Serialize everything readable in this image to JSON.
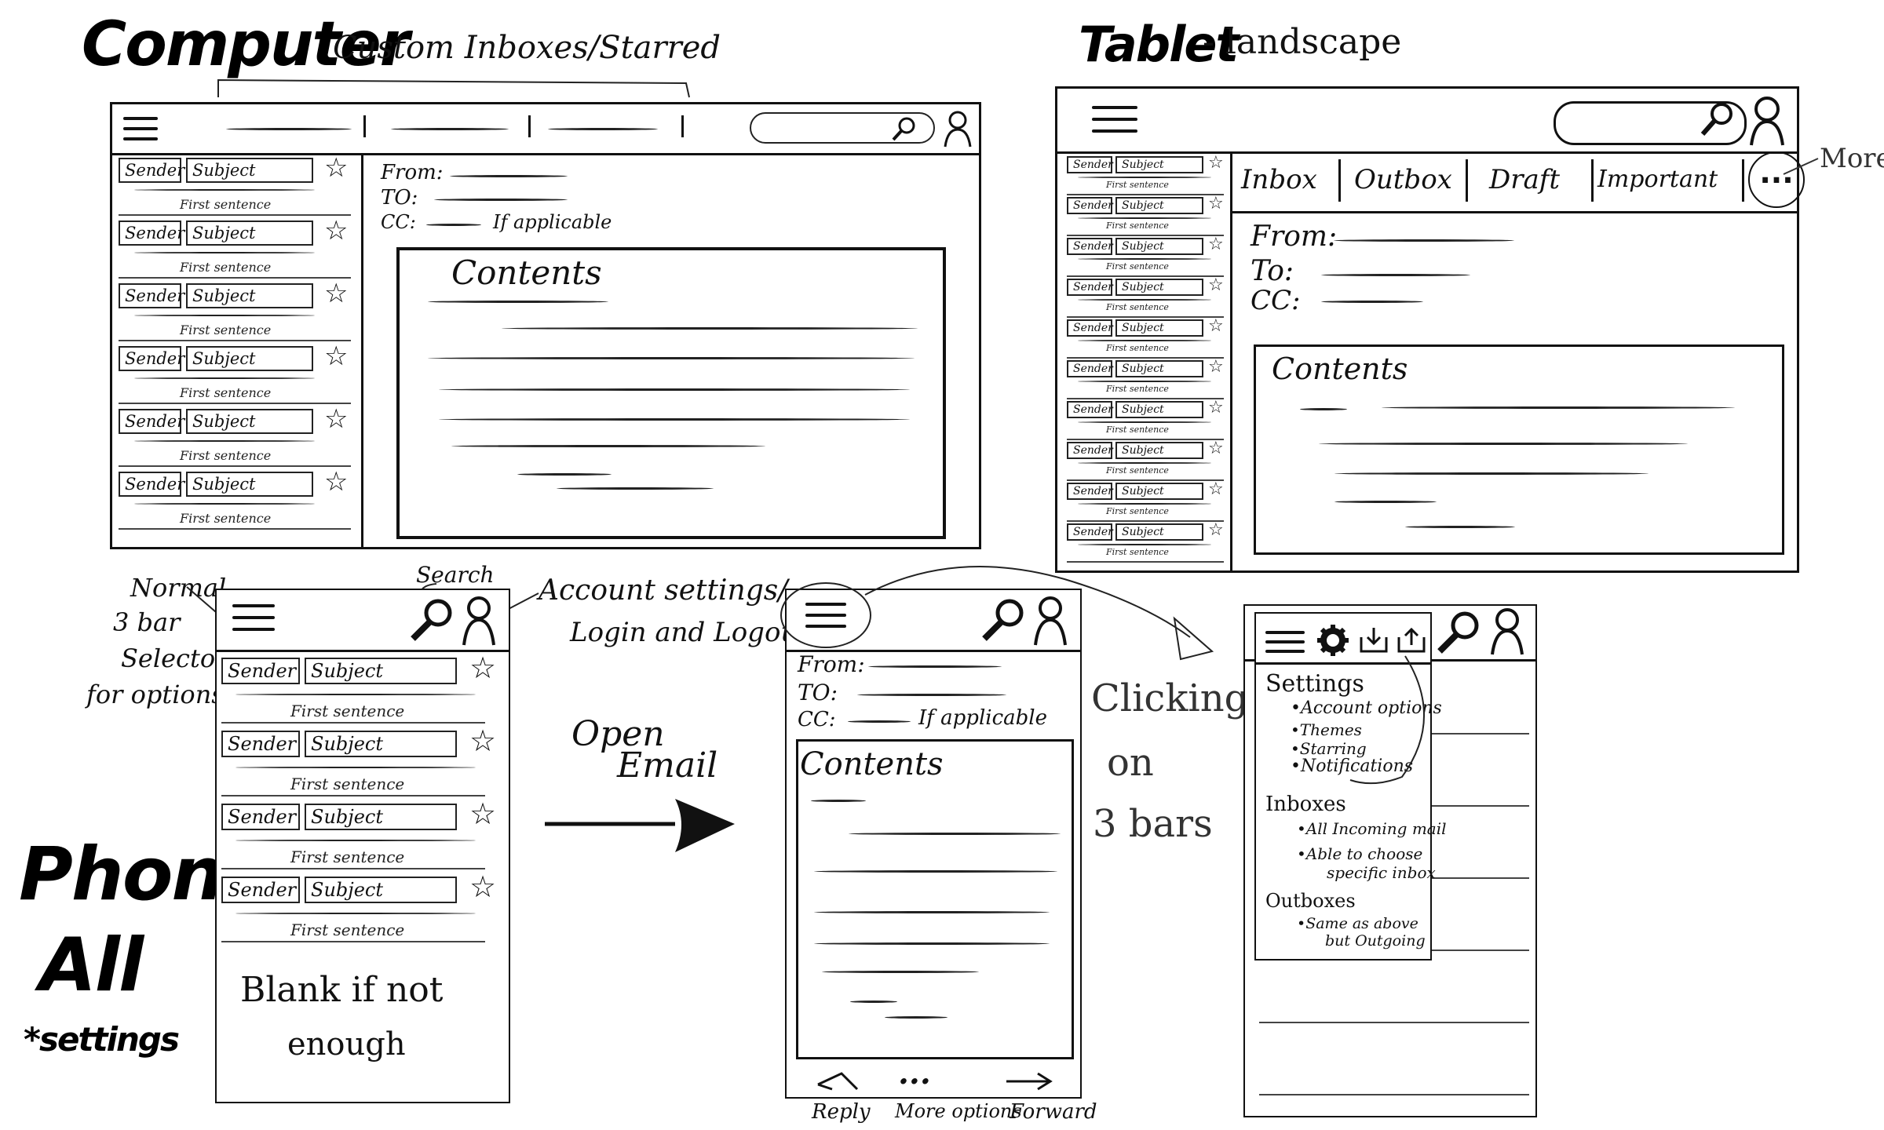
{
  "computer": {
    "title": "Computer",
    "annotation_tabs": "Custom Inboxes/Starred",
    "list_sender": "Sender",
    "list_subject": "Subject",
    "list_sentence": "First sentence",
    "from_label": "From:",
    "to_label": "TO:",
    "cc_label": "CC:",
    "cc_note": "If applicable",
    "contents": "Contents"
  },
  "tablet": {
    "title": "Tablet",
    "subtitle": "- landscape",
    "tabs": [
      "Inbox",
      "Outbox",
      "Draft",
      "Important"
    ],
    "more_button": "...",
    "more_note": "More",
    "from_label": "From:",
    "to_label": "To:",
    "cc_label": "CC:",
    "contents": "Contents",
    "list_sender": "Sender",
    "list_subject": "Subject",
    "list_sentence": "First sentence"
  },
  "phone": {
    "title_line1": "Phone/",
    "title_line2": "All",
    "title_line3": "*settings",
    "note_normal": [
      "Normal",
      "3 bar",
      "Selector",
      "for options"
    ],
    "note_search": "Search",
    "note_account": [
      "Account settings/",
      "Login and Logout"
    ],
    "list_sender": "Sender",
    "list_subject": "Subject",
    "list_sentence": "First sentence",
    "blank_note": [
      "Blank if not",
      "enough"
    ],
    "open_email": [
      "Open",
      "Email"
    ],
    "email_from": "From:",
    "email_to": "TO:",
    "email_cc": "CC:",
    "email_cc_note": "If applicable",
    "email_contents": "Contents",
    "reply": "Reply",
    "more_options": "More options",
    "more_dots": "...",
    "forward": "Forward",
    "clicking_note": [
      "Clicking",
      "on",
      "3 bars"
    ],
    "menu": {
      "settings_head": "Settings",
      "settings_items": [
        "•Account options",
        "•Themes",
        "•Starring",
        "•Notifications"
      ],
      "inboxes_head": "Inboxes",
      "inboxes_items": [
        "•All Incoming mail",
        "•Able to choose",
        "specific inbox"
      ],
      "outboxes_head": "Outboxes",
      "outboxes_items": [
        "•Same as above",
        "but Outgoing"
      ]
    }
  }
}
